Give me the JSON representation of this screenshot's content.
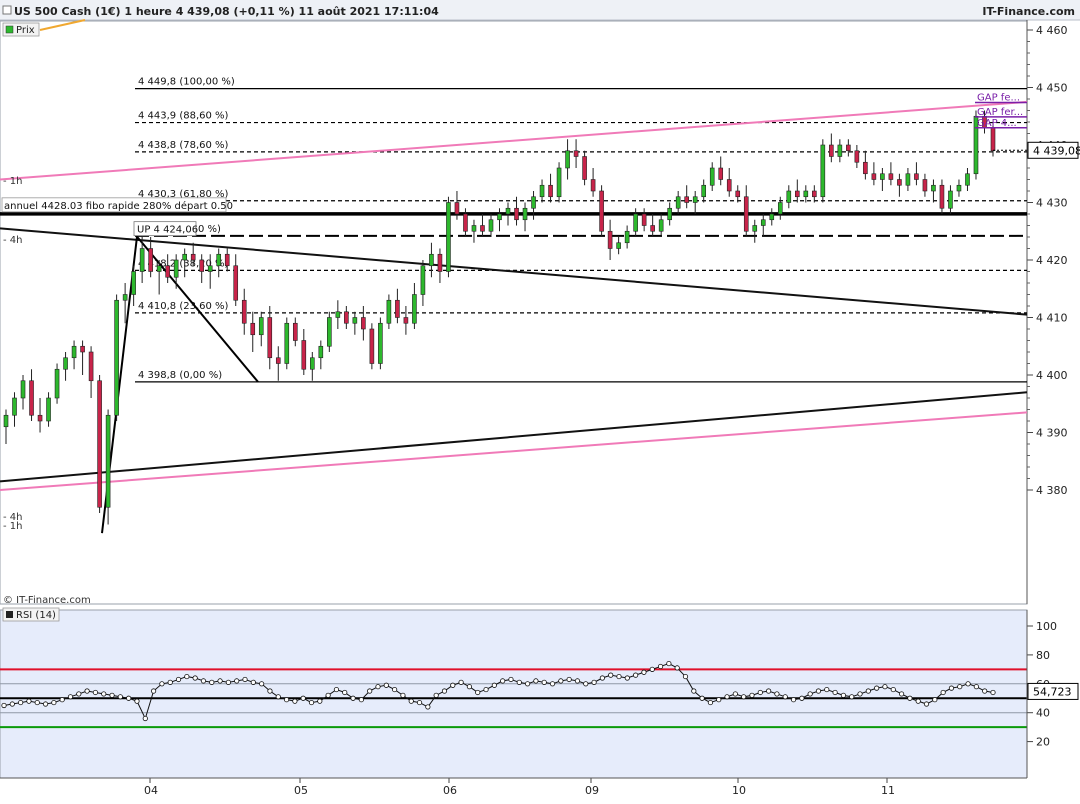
{
  "header": {
    "title": "US 500 Cash (1€) 1 heure 4 439,08 (+0,11 %) 11 août 2021 17:11:04",
    "brand": "IT-Finance.com"
  },
  "price_panel": {
    "legend_label": "Prix",
    "copyright": "© IT-Finance.com",
    "last_price_label": "4 439,08",
    "annotations": {
      "fib_100": "4 449,8 (100,00 %)",
      "fib_886": "4 443,9 (88,60 %)",
      "fib_786": "4 438,8 (78,60 %)",
      "fib_618": "4 430,3 (61,80 %)",
      "fib_500": "0 %)",
      "fib_382": "4 418,2 (38,20 %)",
      "fib_236": "4 410,8 (23,60 %)",
      "fib_0": "4 398,8 (0,00 %)",
      "annual_label": "annuel 4428.03 fibo rapide 280% départ 0.50",
      "up_label": "UP 4 424,06",
      "gap_1": "GAP fe...",
      "gap_2": "GAP fer...",
      "gap_3": "GAP 4...",
      "tf_1h_upper": "- 1h",
      "tf_4h_upper": "- 4h",
      "tf_4h_lower": "- 4h",
      "tf_1h_lower": "- 1h"
    }
  },
  "rsi_panel": {
    "legend_label": "RSI (14)",
    "last_value_label": "54,723"
  },
  "colors": {
    "up": "#2db82d",
    "down": "#c8244a",
    "trend_pink": "#f07ab8",
    "rsi_upper": "#e0102a",
    "rsi_lower": "#0a9a0a",
    "gap": "#7a1fa8"
  },
  "chart_data": [
    {
      "type": "candlestick",
      "title": "US 500 Cash (1€) 1 heure",
      "x_ticks": [
        "04",
        "05",
        "06",
        "09",
        "10",
        "11"
      ],
      "ylim": [
        4372,
        4462
      ],
      "y_ticks": [
        "4 380",
        "4 390",
        "4 400",
        "4 410",
        "4 420",
        "4 430",
        "4 440",
        "4 450",
        "4 460"
      ],
      "last_price": 4439.08,
      "fibonacci_levels": [
        {
          "label": "4 449,8 (100,00 %)",
          "value": 4449.8
        },
        {
          "label": "4 443,9 (88,60 %)",
          "value": 4443.9
        },
        {
          "label": "4 438,8 (78,60 %)",
          "value": 4438.8
        },
        {
          "label": "4 430,3 (61,80 %)",
          "value": 4430.3
        },
        {
          "label": "0 %)",
          "value": 4424.2
        },
        {
          "label": "4 418,2 (38,20 %)",
          "value": 4418.2
        },
        {
          "label": "4 410,8 (23,60 %)",
          "value": 4410.8
        },
        {
          "label": "4 398,8 (0,00 %)",
          "value": 4398.8
        }
      ],
      "candles": [
        [
          4391,
          4394,
          4388,
          4393
        ],
        [
          4393,
          4397,
          4391,
          4396
        ],
        [
          4396,
          4400,
          4394,
          4399
        ],
        [
          4399,
          4401,
          4392,
          4393
        ],
        [
          4393,
          4396,
          4390,
          4392
        ],
        [
          4392,
          4397,
          4391,
          4396
        ],
        [
          4396,
          4402,
          4395,
          4401
        ],
        [
          4401,
          4404,
          4399,
          4403
        ],
        [
          4403,
          4406,
          4401,
          4405
        ],
        [
          4405,
          4406,
          4400,
          4404
        ],
        [
          4404,
          4405,
          4396,
          4399
        ],
        [
          4399,
          4400,
          4376,
          4377
        ],
        [
          4377,
          4394,
          4374,
          4393
        ],
        [
          4393,
          4414,
          4392,
          4413
        ],
        [
          4413,
          4416,
          4409,
          4414
        ],
        [
          4414,
          4419,
          4412,
          4418
        ],
        [
          4418,
          4424,
          4416,
          4422
        ],
        [
          4422,
          4424,
          4417,
          4418
        ],
        [
          4418,
          4420,
          4414,
          4419
        ],
        [
          4419,
          4421,
          4416,
          4417
        ],
        [
          4417,
          4421,
          4415,
          4420
        ],
        [
          4420,
          4422,
          4417,
          4421
        ],
        [
          4421,
          4423,
          4419,
          4420
        ],
        [
          4420,
          4421,
          4416,
          4418
        ],
        [
          4418,
          4421,
          4415,
          4419
        ],
        [
          4419,
          4422,
          4417,
          4421
        ],
        [
          4421,
          4422,
          4418,
          4419
        ],
        [
          4419,
          4421,
          4412,
          4413
        ],
        [
          4413,
          4415,
          4407,
          4409
        ],
        [
          4409,
          4411,
          4404,
          4407
        ],
        [
          4407,
          4411,
          4405,
          4410
        ],
        [
          4410,
          4412,
          4401,
          4403
        ],
        [
          4403,
          4405,
          4399,
          4402
        ],
        [
          4402,
          4410,
          4401,
          4409
        ],
        [
          4409,
          4410,
          4405,
          4406
        ],
        [
          4406,
          4408,
          4400,
          4401
        ],
        [
          4401,
          4404,
          4399,
          4403
        ],
        [
          4403,
          4406,
          4401,
          4405
        ],
        [
          4405,
          4411,
          4404,
          4410
        ],
        [
          4410,
          4413,
          4408,
          4411
        ],
        [
          4411,
          4412,
          4408,
          4409
        ],
        [
          4409,
          4411,
          4407,
          4410
        ],
        [
          4410,
          4412,
          4406,
          4408
        ],
        [
          4408,
          4409,
          4401,
          4402
        ],
        [
          4402,
          4410,
          4401,
          4409
        ],
        [
          4409,
          4414,
          4408,
          4413
        ],
        [
          4413,
          4415,
          4409,
          4410
        ],
        [
          4410,
          4412,
          4407,
          4409
        ],
        [
          4409,
          4416,
          4408,
          4414
        ],
        [
          4414,
          4420,
          4412,
          4419
        ],
        [
          4419,
          4423,
          4417,
          4421
        ],
        [
          4421,
          4422,
          4416,
          4418
        ],
        [
          4418,
          4431,
          4417,
          4430
        ],
        [
          4430,
          4432,
          4427,
          4428
        ],
        [
          4428,
          4429,
          4424,
          4425
        ],
        [
          4425,
          4427,
          4423,
          4426
        ],
        [
          4426,
          4428,
          4424,
          4425
        ],
        [
          4425,
          4428,
          4424,
          4427
        ],
        [
          4427,
          4429,
          4425,
          4428
        ],
        [
          4428,
          4430,
          4426,
          4429
        ],
        [
          4429,
          4431,
          4426,
          4427
        ],
        [
          4427,
          4430,
          4425,
          4429
        ],
        [
          4429,
          4432,
          4427,
          4431
        ],
        [
          4431,
          4434,
          4430,
          4433
        ],
        [
          4433,
          4435,
          4430,
          4431
        ],
        [
          4431,
          4437,
          4430,
          4436
        ],
        [
          4436,
          4441,
          4434,
          4439
        ],
        [
          4439,
          4441,
          4436,
          4438
        ],
        [
          4438,
          4439,
          4433,
          4434
        ],
        [
          4434,
          4436,
          4431,
          4432
        ],
        [
          4432,
          4433,
          4424,
          4425
        ],
        [
          4425,
          4427,
          4420,
          4422
        ],
        [
          4422,
          4424,
          4421,
          4423
        ],
        [
          4423,
          4426,
          4422,
          4425
        ],
        [
          4425,
          4429,
          4424,
          4428
        ],
        [
          4428,
          4429,
          4425,
          4426
        ],
        [
          4426,
          4428,
          4424,
          4425
        ],
        [
          4425,
          4428,
          4424,
          4427
        ],
        [
          4427,
          4430,
          4426,
          4429
        ],
        [
          4429,
          4432,
          4428,
          4431
        ],
        [
          4431,
          4433,
          4429,
          4430
        ],
        [
          4430,
          4432,
          4428,
          4431
        ],
        [
          4431,
          4434,
          4430,
          4433
        ],
        [
          4433,
          4437,
          4432,
          4436
        ],
        [
          4436,
          4438,
          4433,
          4434
        ],
        [
          4434,
          4436,
          4431,
          4432
        ],
        [
          4432,
          4433,
          4430,
          4431
        ],
        [
          4431,
          4433,
          4424,
          4425
        ],
        [
          4425,
          4427,
          4423,
          4426
        ],
        [
          4426,
          4428,
          4424,
          4427
        ],
        [
          4427,
          4429,
          4426,
          4428
        ],
        [
          4428,
          4431,
          4427,
          4430
        ],
        [
          4430,
          4433,
          4429,
          4432
        ],
        [
          4432,
          4434,
          4430,
          4431
        ],
        [
          4431,
          4433,
          4430,
          4432
        ],
        [
          4432,
          4433,
          4430,
          4431
        ],
        [
          4431,
          4441,
          4430,
          4440
        ],
        [
          4440,
          4442,
          4437,
          4438
        ],
        [
          4438,
          4441,
          4437,
          4440
        ],
        [
          4440,
          4441,
          4438,
          4439
        ],
        [
          4439,
          4440,
          4436,
          4437
        ],
        [
          4437,
          4439,
          4434,
          4435
        ],
        [
          4435,
          4437,
          4433,
          4434
        ],
        [
          4434,
          4436,
          4432,
          4435
        ],
        [
          4435,
          4437,
          4433,
          4434
        ],
        [
          4434,
          4435,
          4431,
          4433
        ],
        [
          4433,
          4436,
          4432,
          4435
        ],
        [
          4435,
          4437,
          4433,
          4434
        ],
        [
          4434,
          4435,
          4431,
          4432
        ],
        [
          4432,
          4434,
          4430,
          4433
        ],
        [
          4433,
          4434,
          4428,
          4429
        ],
        [
          4429,
          4433,
          4428,
          4432
        ],
        [
          4432,
          4434,
          4431,
          4433
        ],
        [
          4433,
          4436,
          4432,
          4435
        ],
        [
          4435,
          4446,
          4434,
          4445
        ],
        [
          4445,
          4446,
          4442,
          4443
        ],
        [
          4443,
          4444,
          4438,
          4439
        ]
      ],
      "trendlines": [
        {
          "name": "pink-upper",
          "points": [
            [
              "start",
              4434
            ],
            [
              "end",
              4447.5
            ]
          ]
        },
        {
          "name": "pink-lower",
          "points": [
            [
              "start",
              4380
            ],
            [
              "end",
              4393.5
            ]
          ]
        },
        {
          "name": "black-upper",
          "points": [
            [
              "start",
              4425.5
            ],
            [
              "end",
              4410.5
            ]
          ]
        },
        {
          "name": "black-lower",
          "points": [
            [
              "start",
              4381.5
            ],
            [
              "end",
              4397
            ]
          ]
        }
      ]
    },
    {
      "type": "line",
      "title": "RSI (14)",
      "ylim": [
        10,
        105
      ],
      "y_ticks": [
        "20",
        "40",
        "60",
        "80",
        "100"
      ],
      "overbought": 70,
      "oversold": 30,
      "last_value": 54.723,
      "values": [
        45,
        46,
        47,
        48,
        47,
        46,
        47,
        49,
        51,
        53,
        55,
        54,
        53,
        52,
        51,
        50,
        48,
        36,
        55,
        60,
        61,
        63,
        65,
        64,
        62,
        61,
        62,
        61,
        62,
        63,
        61,
        60,
        55,
        51,
        49,
        48,
        50,
        47,
        48,
        52,
        56,
        54,
        50,
        49,
        55,
        58,
        59,
        56,
        52,
        48,
        47,
        44,
        52,
        55,
        59,
        61,
        58,
        54,
        56,
        59,
        62,
        63,
        61,
        60,
        62,
        61,
        60,
        62,
        63,
        62,
        60,
        61,
        64,
        66,
        65,
        64,
        66,
        68,
        70,
        72,
        74,
        71,
        65,
        55,
        50,
        47,
        49,
        51,
        53,
        51,
        52,
        54,
        55,
        53,
        51,
        49,
        50,
        53,
        55,
        56,
        54,
        52,
        51,
        53,
        55,
        57,
        58,
        56,
        53,
        50,
        48,
        46,
        49,
        54,
        57,
        58,
        60,
        58,
        55,
        54
      ]
    }
  ]
}
